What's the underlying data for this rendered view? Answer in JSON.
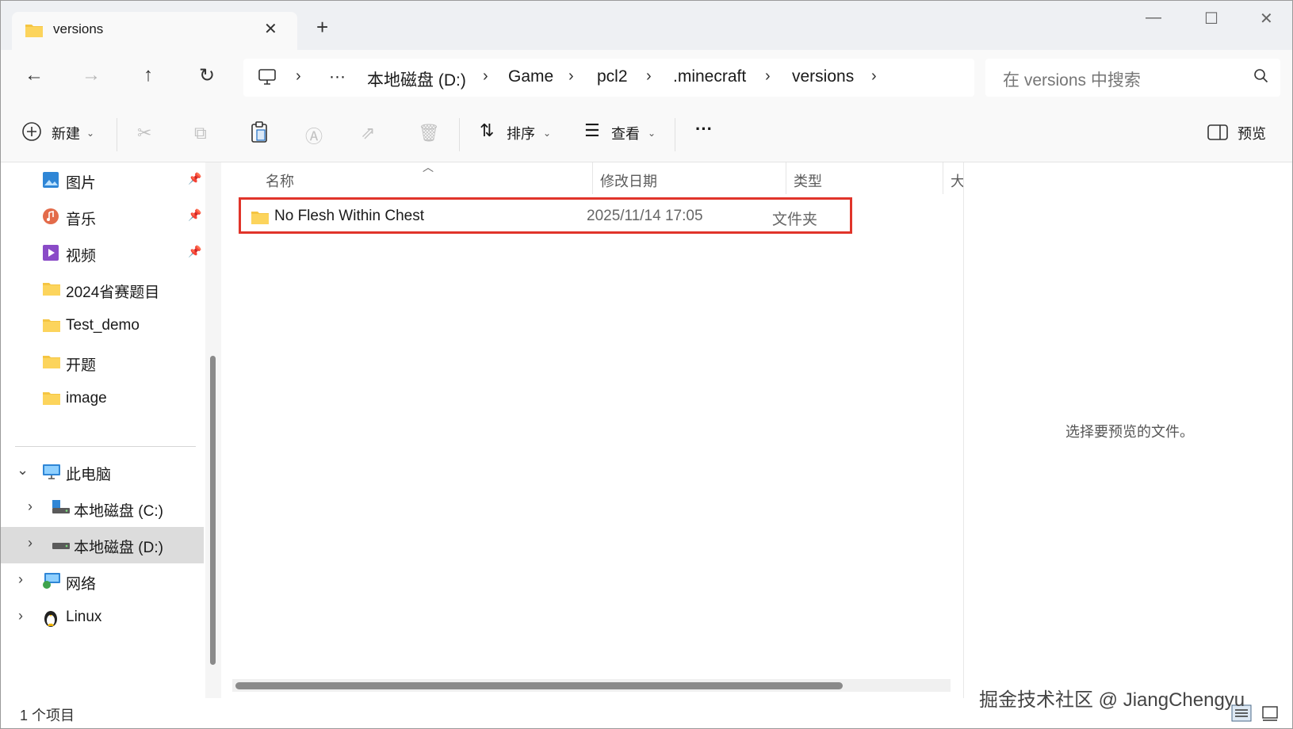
{
  "window": {
    "tab_title": "versions",
    "new_tab": "+",
    "tab_close": "✕",
    "minimize": "—",
    "maximize": "☐",
    "close": "✕"
  },
  "breadcrumb": {
    "overflow": "···",
    "items": [
      "本地磁盘 (D:)",
      "Game",
      "pcl2",
      ".minecraft",
      "versions"
    ]
  },
  "search": {
    "placeholder": "在 versions 中搜索"
  },
  "toolbar": {
    "new_label": "新建",
    "sort_label": "排序",
    "view_label": "查看",
    "more_label": "···",
    "preview_label": "预览"
  },
  "sidebar": {
    "quick_access": [
      {
        "label": "图片",
        "icon": "pictures-icon",
        "pinned": true
      },
      {
        "label": "音乐",
        "icon": "music-icon",
        "pinned": true
      },
      {
        "label": "视频",
        "icon": "videos-icon",
        "pinned": true
      },
      {
        "label": "2024省赛题目",
        "icon": "folder-icon",
        "pinned": false
      },
      {
        "label": "Test_demo",
        "icon": "folder-icon",
        "pinned": false
      },
      {
        "label": "开题",
        "icon": "folder-icon",
        "pinned": false
      },
      {
        "label": "image",
        "icon": "folder-icon",
        "pinned": false
      }
    ],
    "this_pc": "此电脑",
    "drive_c": "本地磁盘 (C:)",
    "drive_d": "本地磁盘 (D:)",
    "network": "网络",
    "linux": "Linux"
  },
  "columns": {
    "name": "名称",
    "modified": "修改日期",
    "type": "类型",
    "size": "大"
  },
  "files": [
    {
      "name": "No Flesh Within Chest",
      "modified": "2025/11/14 17:05",
      "type": "文件夹"
    }
  ],
  "preview": {
    "message": "选择要预览的文件。"
  },
  "status": {
    "item_count": "1 个项目"
  },
  "watermark": "掘金技术社区 @ JiangChengyu",
  "colors": {
    "highlight_border": "#e0342a",
    "folder": "#f5c542",
    "selected_bg": "#dcdcdc"
  }
}
